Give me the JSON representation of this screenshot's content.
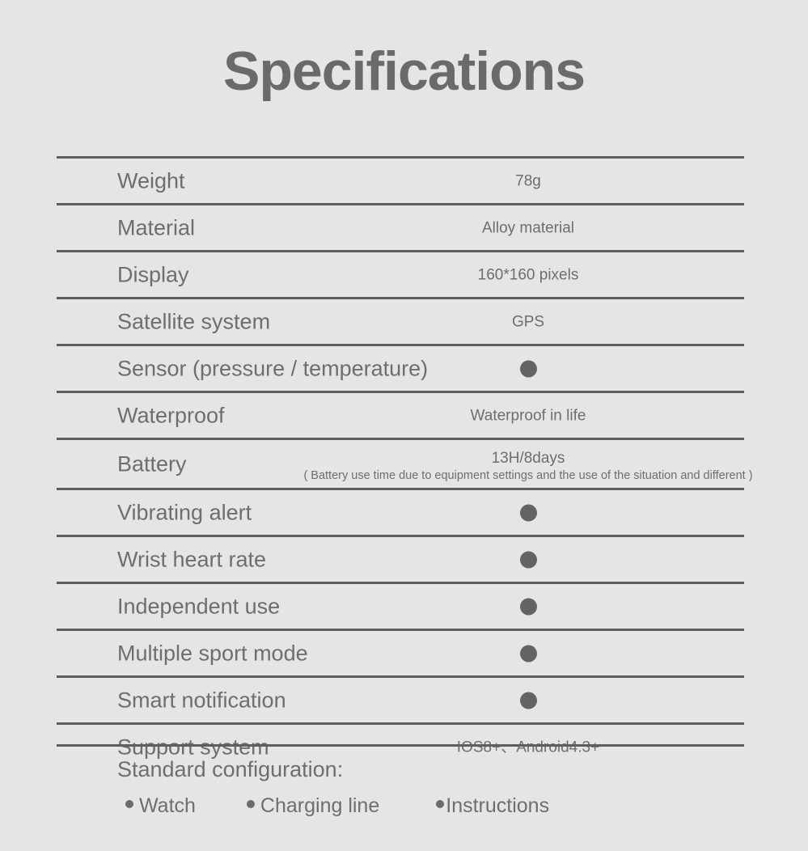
{
  "page": {
    "title": "Specifications",
    "background_color": "#e5e5e5",
    "text_color": "#6e6e6e",
    "rule_color": "#5e5e5e",
    "dot_color": "#636363"
  },
  "spec_table": {
    "rows": [
      {
        "label": "Weight",
        "value": "78g",
        "type": "text"
      },
      {
        "label": "Material",
        "value": "Alloy material",
        "type": "text"
      },
      {
        "label": "Display",
        "value": "160*160 pixels",
        "type": "text"
      },
      {
        "label": "Satellite system",
        "value": "GPS",
        "type": "text"
      },
      {
        "label": "Sensor (pressure / temperature)",
        "value": "",
        "type": "dot"
      },
      {
        "label": "Waterproof",
        "value": "Waterproof in life",
        "type": "text"
      },
      {
        "label": "Battery",
        "value": "13H/8days",
        "type": "text-with-note",
        "note": "( Battery use time due to equipment settings and the use of the situation and different )"
      },
      {
        "label": "Vibrating alert",
        "value": "",
        "type": "dot"
      },
      {
        "label": "Wrist heart rate",
        "value": "",
        "type": "dot"
      },
      {
        "label": "Independent use",
        "value": "",
        "type": "dot"
      },
      {
        "label": "Multiple sport mode",
        "value": "",
        "type": "dot"
      },
      {
        "label": "Smart notification",
        "value": "",
        "type": "dot"
      },
      {
        "label": "Support system",
        "value": "IOS8+、Android4.3+",
        "type": "text"
      }
    ]
  },
  "standard_configuration": {
    "title": "Standard configuration:",
    "items": [
      {
        "label": "Watch"
      },
      {
        "label": "Charging line"
      },
      {
        "label": "Instructions"
      }
    ]
  }
}
